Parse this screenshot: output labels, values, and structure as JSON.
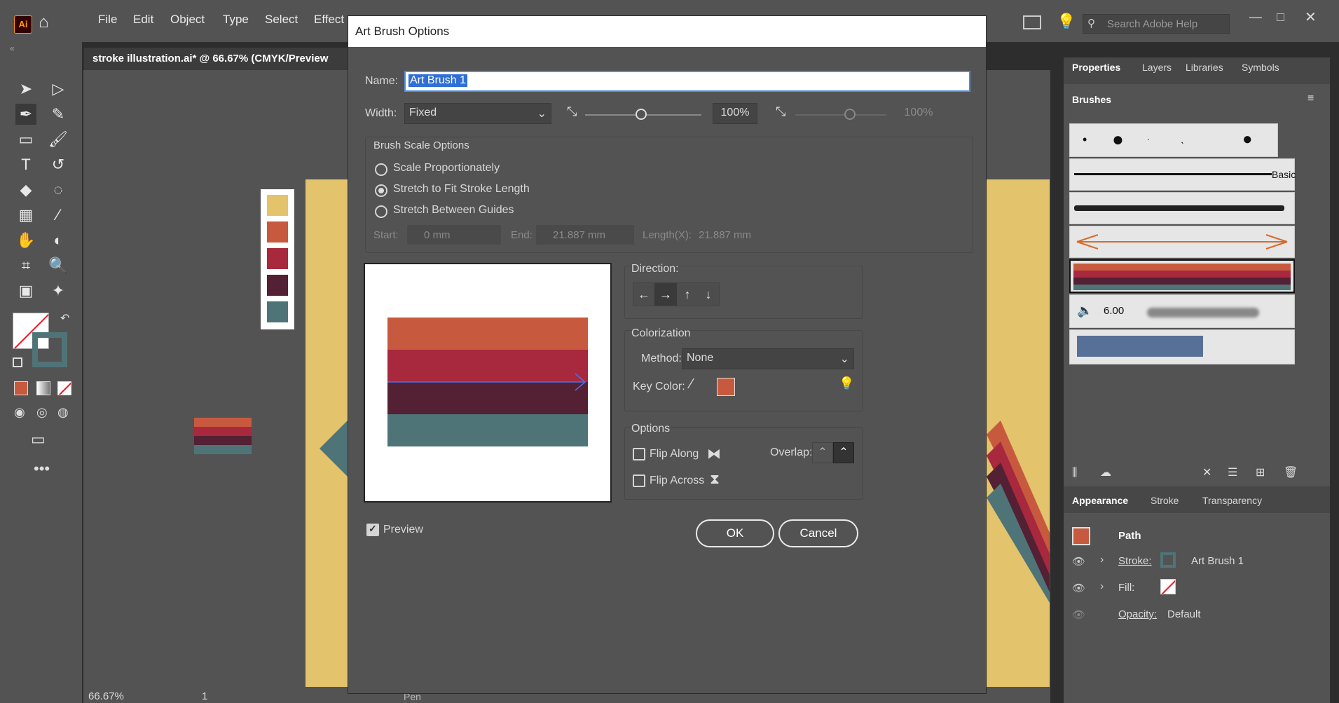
{
  "app": {
    "logo": "Ai",
    "menu": [
      "File",
      "Edit",
      "Object",
      "Type",
      "Select",
      "Effect"
    ],
    "document_tab": "stroke illustration.ai* @ 66.67% (CMYK/Preview",
    "search_placeholder": "Search Adobe Help"
  },
  "status": {
    "zoom": "66.67%",
    "page": "1",
    "tool": "Pen"
  },
  "swatches": [
    "#e3c36b",
    "#c75a3e",
    "#a8283e",
    "#532034",
    "#4f7478"
  ],
  "dialog": {
    "title": "Art Brush Options",
    "name_label": "Name:",
    "name_value": "Art Brush 1",
    "width_label": "Width:",
    "width_select": "Fixed",
    "width_value": "100%",
    "width_value2": "100%",
    "brush_scale_title": "Brush Scale Options",
    "scale_options": [
      "Scale Proportionately",
      "Stretch to Fit Stroke Length",
      "Stretch Between Guides"
    ],
    "scale_selected": 1,
    "start_label": "Start:",
    "start_value": "0 mm",
    "end_label": "End:",
    "end_value": "21.887 mm",
    "length_label": "Length(X):",
    "length_value": "21.887 mm",
    "direction_label": "Direction:",
    "direction_arrows": [
      "←",
      "→",
      "↑",
      "↓"
    ],
    "colorization_label": "Colorization",
    "method_label": "Method:",
    "method_value": "None",
    "key_color_label": "Key Color:",
    "key_color": "#c75a3e",
    "options_label": "Options",
    "flip_along": "Flip Along",
    "flip_across": "Flip Across",
    "overlap_label": "Overlap:",
    "preview_label": "Preview",
    "preview_checked": true,
    "ok": "OK",
    "cancel": "Cancel",
    "preview_stripes": [
      "#c75a3e",
      "#a8283e",
      "#532034",
      "#4f7478"
    ]
  },
  "panels": {
    "tabs": [
      "Properties",
      "Layers",
      "Libraries",
      "Symbols"
    ],
    "brushes_title": "Brushes",
    "basic_label": "Basic",
    "brush_size": "6.00",
    "appearance_tabs": [
      "Appearance",
      "Stroke",
      "Transparency"
    ],
    "path_label": "Path",
    "stroke_label": "Stroke:",
    "stroke_value": "Art Brush 1",
    "fill_label": "Fill:",
    "opacity_label": "Opacity:",
    "opacity_value": "Default"
  }
}
